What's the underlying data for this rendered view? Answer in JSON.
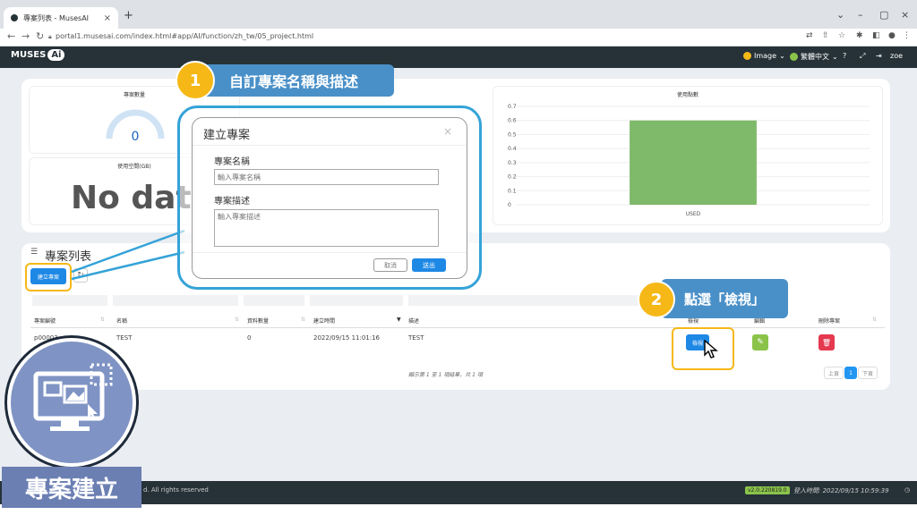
{
  "browser": {
    "tab_title": "專案列表 - MusesAI",
    "url": "portal1.musesai.com/index.html#app/AI/function/zh_tw/05_project.html"
  },
  "header": {
    "logo_text": "MUSES",
    "logo_ai": "Ai",
    "image_menu": "Image",
    "language_menu": "繁體中文",
    "user": "zoe"
  },
  "dashboard": {
    "project_count_label": "專案數量",
    "project_count_value": "0",
    "storage_label": "使用空間(GB)",
    "storage_value": "No dat",
    "usage_label": "使用點數"
  },
  "chart_data": {
    "type": "bar",
    "categories": [
      "USED"
    ],
    "values": [
      0.6
    ],
    "title": "使用點數",
    "ylim": [
      0,
      0.7
    ],
    "yticks": [
      "0",
      "0.1",
      "0.2",
      "0.3",
      "0.4",
      "0.5",
      "0.6",
      "0.7"
    ],
    "bar_color": "#7fb96a"
  },
  "project_list": {
    "title": "專案列表",
    "create_button": "建立專案",
    "columns": [
      "專案編號",
      "名稱",
      "資料數量",
      "建立時間",
      "描述",
      "檢視",
      "編輯",
      "刪除專案"
    ],
    "rows": [
      {
        "id": "p00003",
        "name": "TEST",
        "count": "0",
        "created": "2022/09/15 11:01:16",
        "desc": "TEST",
        "view": "檢視"
      }
    ],
    "pagination_info": "顯示第 1 至 1 項結果，共 1 項",
    "prev": "上頁",
    "page": "1",
    "next": "下頁"
  },
  "modal": {
    "title": "建立專案",
    "close": "×",
    "name_label": "專案名稱",
    "name_placeholder": "輸入專案名稱",
    "desc_label": "專案描述",
    "desc_placeholder": "輸入專案描述",
    "cancel": "取消",
    "submit": "送出"
  },
  "callouts": {
    "step1_num": "1",
    "step1_text": "自訂專案名稱與描述",
    "step2_num": "2",
    "step2_text": "點選「檢視」"
  },
  "badge": {
    "text": "專案建立"
  },
  "footer": {
    "copyright": "d. All rights reserved",
    "version": "v2.0.220819.0",
    "login_time": "登入時間: 2022/09/15 10:59:39"
  },
  "colors": {
    "accent": "#1e88e5",
    "callout": "#4a90c8",
    "step_num": "#f6b817",
    "edit": "#8bc34a",
    "delete": "#e53950"
  }
}
